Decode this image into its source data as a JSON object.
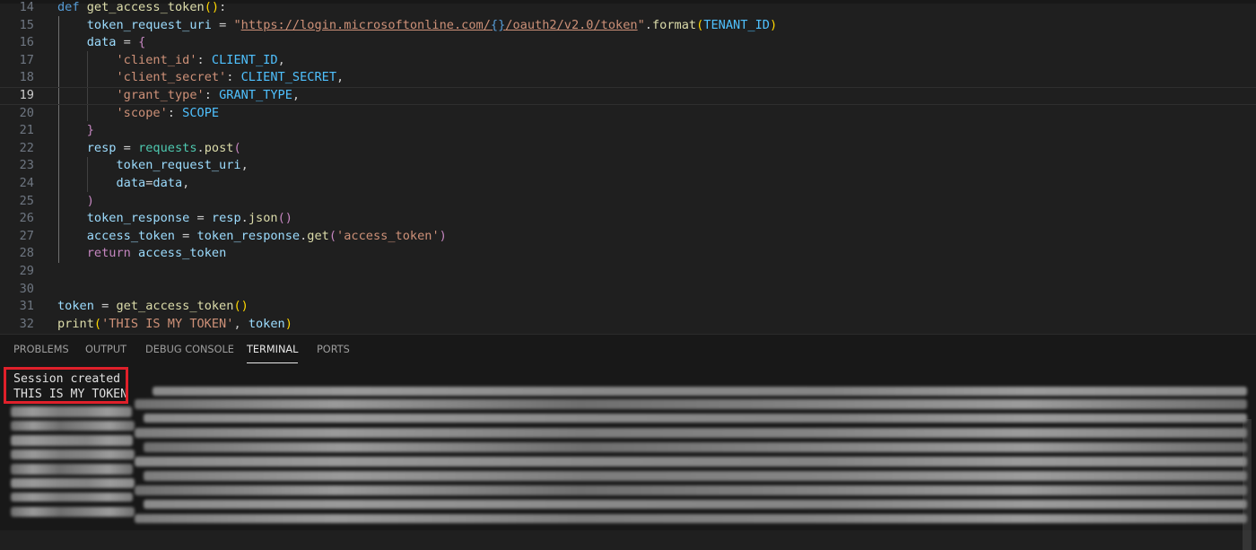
{
  "editor": {
    "lines": [
      {
        "n": "14",
        "html": "<span class=\"kw\">def</span> <span class=\"fn\">get_access_token</span><span class=\"brace\">()</span>:"
      },
      {
        "n": "15",
        "html": "    <span class=\"var\">token_request_uri</span> = <span class=\"str\">\"</span><span class=\"url\">https://login.microsoftonline.com/<span class=\"ph\">{}</span>/oauth2/v2.0/token</span><span class=\"str\">\"</span>.<span class=\"fn\">format</span><span class=\"brace\">(</span><span class=\"const\">TENANT_ID</span><span class=\"brace\">)</span>"
      },
      {
        "n": "16",
        "html": "    <span class=\"var\">data</span> = <span class=\"ctl\">{</span>"
      },
      {
        "n": "17",
        "html": "        <span class=\"str\">'client_id'</span>: <span class=\"const\">CLIENT_ID</span>,"
      },
      {
        "n": "18",
        "html": "        <span class=\"str\">'client_secret'</span>: <span class=\"const\">CLIENT_SECRET</span>,"
      },
      {
        "n": "19",
        "html": "        <span class=\"str\">'grant_type'</span>: <span class=\"const\">GRANT_TYPE</span>,"
      },
      {
        "n": "20",
        "html": "        <span class=\"str\">'scope'</span>: <span class=\"const\">SCOPE</span>"
      },
      {
        "n": "21",
        "html": "    <span class=\"ctl\">}</span>"
      },
      {
        "n": "22",
        "html": "    <span class=\"var\">resp</span> = <span class=\"mod\">requests</span>.<span class=\"fn\">post</span><span class=\"ctl\">(</span>"
      },
      {
        "n": "23",
        "html": "        <span class=\"var\">token_request_uri</span>,"
      },
      {
        "n": "24",
        "html": "        <span class=\"var\">data</span>=<span class=\"var\">data</span>,"
      },
      {
        "n": "25",
        "html": "    <span class=\"ctl\">)</span>"
      },
      {
        "n": "26",
        "html": "    <span class=\"var\">token_response</span> = <span class=\"var\">resp</span>.<span class=\"fn\">json</span><span class=\"ctl\">()</span>"
      },
      {
        "n": "27",
        "html": "    <span class=\"var\">access_token</span> = <span class=\"var\">token_response</span>.<span class=\"fn\">get</span><span class=\"ctl\">(</span><span class=\"str\">'access_token'</span><span class=\"ctl\">)</span>"
      },
      {
        "n": "28",
        "html": "    <span class=\"ctl\">return</span> <span class=\"var\">access_token</span>"
      },
      {
        "n": "29",
        "html": ""
      },
      {
        "n": "30",
        "html": ""
      },
      {
        "n": "31",
        "html": "<span class=\"var\">token</span> = <span class=\"fn\">get_access_token</span><span class=\"brace\">()</span>"
      },
      {
        "n": "32",
        "html": "<span class=\"fn\">print</span><span class=\"brace\">(</span><span class=\"str\">'THIS IS MY TOKEN'</span>, <span class=\"var\">token</span><span class=\"brace\">)</span>"
      }
    ],
    "current_line": "19"
  },
  "panel": {
    "tabs": [
      {
        "label": "PROBLEMS",
        "active": false
      },
      {
        "label": "OUTPUT",
        "active": false
      },
      {
        "label": "DEBUG CONSOLE",
        "active": false
      },
      {
        "label": "TERMINAL",
        "active": true
      },
      {
        "label": "PORTS",
        "active": false
      }
    ]
  },
  "terminal": {
    "lines": [
      "Session created",
      "THIS IS MY TOKEN"
    ],
    "highlight_color": "#e0202a"
  },
  "colors": {
    "editor_bg": "#1f1f1f",
    "panel_bg": "#181818"
  }
}
